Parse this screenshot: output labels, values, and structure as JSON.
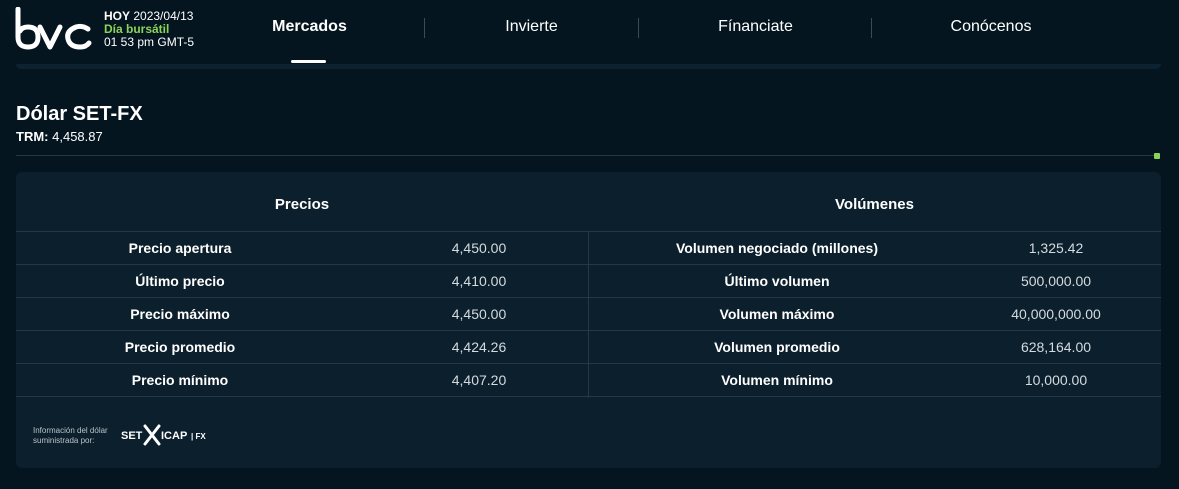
{
  "header": {
    "logo_alt": "bvc",
    "today_label": "HOY",
    "date": "2023/04/13",
    "status": "Día bursátil",
    "time": "01 53 pm GMT-5",
    "nav": [
      {
        "label": "Mercados",
        "active": true
      },
      {
        "label": "Invierte",
        "active": false
      },
      {
        "label": "Fínanciate",
        "active": false
      },
      {
        "label": "Conócenos",
        "active": false
      }
    ]
  },
  "page": {
    "title": "Dólar SET-FX",
    "trm_label": "TRM:",
    "trm_value": "4,458.87"
  },
  "table": {
    "left_header": "Precios",
    "right_header": "Volúmenes",
    "rows": [
      {
        "left_label": "Precio apertura",
        "left_value": "4,450.00",
        "right_label": "Volumen negociado (millones)",
        "right_value": "1,325.42"
      },
      {
        "left_label": "Último precio",
        "left_value": "4,410.00",
        "right_label": "Último volumen",
        "right_value": "500,000.00"
      },
      {
        "left_label": "Precio máximo",
        "left_value": "4,450.00",
        "right_label": "Volumen máximo",
        "right_value": "40,000,000.00"
      },
      {
        "left_label": "Precio promedio",
        "left_value": "4,424.26",
        "right_label": "Volumen promedio",
        "right_value": "628,164.00"
      },
      {
        "left_label": "Precio mínimo",
        "left_value": "4,407.20",
        "right_label": "Volumen mínimo",
        "right_value": "10,000.00"
      }
    ]
  },
  "footer": {
    "note_line1": "Información del dólar",
    "note_line2": "suministrada por:",
    "provider_logo_text": "SET ICAP | FX"
  },
  "colors": {
    "background": "#041520",
    "card": "#0c1f2c",
    "accent_green": "#8bd45a"
  }
}
